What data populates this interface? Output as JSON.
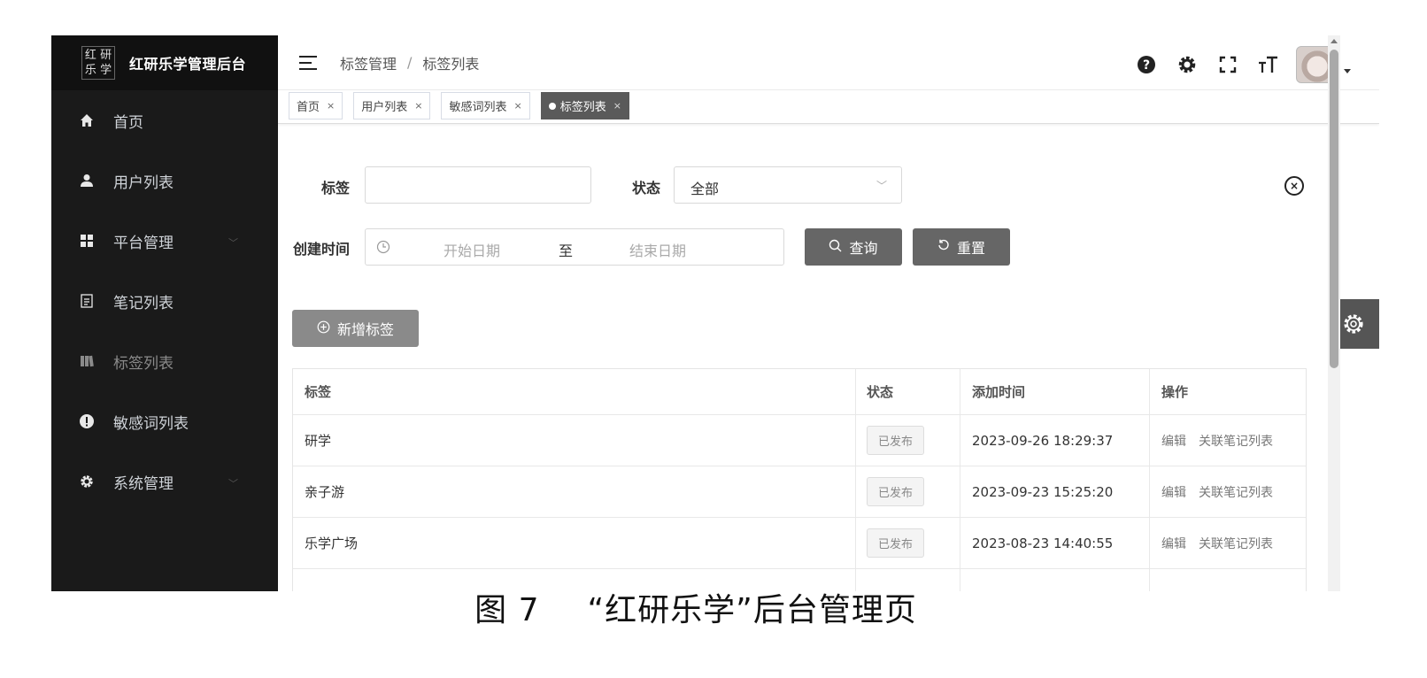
{
  "sidebar": {
    "logo_chars": [
      "红",
      "研",
      "乐",
      "学"
    ],
    "app_title": "红研乐学管理后台",
    "items": [
      {
        "label": "首页",
        "icon": "home-icon"
      },
      {
        "label": "用户列表",
        "icon": "user-icon"
      },
      {
        "label": "平台管理",
        "icon": "grid-icon",
        "has_submenu": true
      },
      {
        "label": "笔记列表",
        "icon": "document-icon"
      },
      {
        "label": "标签列表",
        "icon": "book-icon",
        "active": true
      },
      {
        "label": "敏感词列表",
        "icon": "exclamation-icon"
      },
      {
        "label": "系统管理",
        "icon": "gear-icon",
        "has_submenu": true
      }
    ]
  },
  "header": {
    "breadcrumb": [
      "标签管理",
      "标签列表"
    ],
    "tools": [
      "help-icon",
      "settings-icon",
      "fullscreen-icon",
      "font-size-icon"
    ]
  },
  "tabs": [
    {
      "label": "首页",
      "active": false
    },
    {
      "label": "用户列表",
      "active": false
    },
    {
      "label": "敏感词列表",
      "active": false
    },
    {
      "label": "标签列表",
      "active": true
    }
  ],
  "search": {
    "tag_label": "标签",
    "tag_value": "",
    "status_label": "状态",
    "status_value": "全部",
    "created_label": "创建时间",
    "start_placeholder": "开始日期",
    "range_separator": "至",
    "end_placeholder": "结束日期",
    "query_button": "查询",
    "reset_button": "重置"
  },
  "toolbar": {
    "add_button": "新增标签"
  },
  "table": {
    "headers": [
      "标签",
      "状态",
      "添加时间",
      "操作"
    ],
    "rows": [
      {
        "tag": "研学",
        "status": "已发布",
        "time": "2023-09-26 18:29:37",
        "edit": "编辑",
        "link": "关联笔记列表"
      },
      {
        "tag": "亲子游",
        "status": "已发布",
        "time": "2023-09-23 15:25:20",
        "edit": "编辑",
        "link": "关联笔记列表"
      },
      {
        "tag": "乐学广场",
        "status": "已发布",
        "time": "2023-08-23 14:40:55",
        "edit": "编辑",
        "link": "关联笔记列表"
      }
    ]
  },
  "caption": {
    "number": "图 7",
    "text": "“红研乐学”后台管理页"
  }
}
